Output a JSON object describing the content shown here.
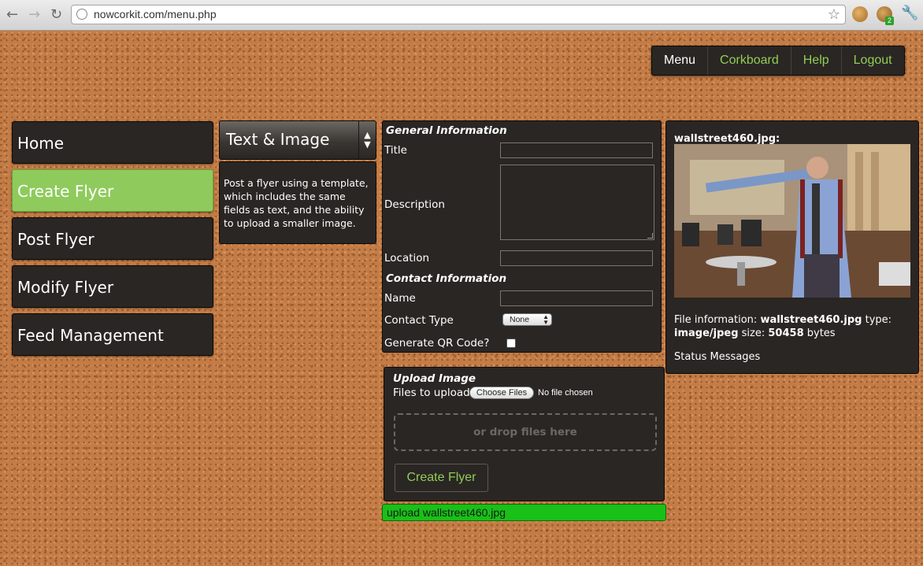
{
  "browser": {
    "url": "nowcorkit.com/menu.php",
    "ext_badge": "2"
  },
  "topnav": [
    {
      "label": "Menu",
      "active": true
    },
    {
      "label": "Corkboard"
    },
    {
      "label": "Help"
    },
    {
      "label": "Logout"
    }
  ],
  "leftmenu": [
    {
      "label": "Home"
    },
    {
      "label": "Create Flyer",
      "active": true
    },
    {
      "label": "Post Flyer"
    },
    {
      "label": "Modify Flyer"
    },
    {
      "label": "Feed Management"
    }
  ],
  "template": {
    "selected": "Text & Image",
    "description": "Post a flyer using a template, which includes the same fields as text, and the ability to upload a smaller image."
  },
  "general": {
    "heading": "General Information",
    "title_label": "Title",
    "description_label": "Description",
    "location_label": "Location",
    "contact_heading": "Contact Information",
    "name_label": "Name",
    "contact_type_label": "Contact Type",
    "contact_type_value": "None",
    "qr_label": "Generate QR Code?"
  },
  "upload": {
    "heading": "Upload Image",
    "files_label": "Files to upload:",
    "choose_button": "Choose Files",
    "no_file": "No file chosen",
    "drop_text": "or drop files here",
    "create_button": "Create Flyer",
    "progress_text": "upload wallstreet460.jpg",
    "progress_color": "#18c018"
  },
  "preview": {
    "filename_heading": "wallstreet460.jpg:",
    "info_prefix": "File information: ",
    "info_name": "wallstreet460.jpg",
    "type_prefix": " type: ",
    "type_value": "image/jpeg",
    "size_prefix": " size: ",
    "size_value": "50458",
    "size_suffix": " bytes",
    "status": "Status Messages"
  },
  "colors": {
    "accent_green": "#8ecb5c",
    "panel_dark": "#2a2623",
    "cork": "#c47c46"
  }
}
